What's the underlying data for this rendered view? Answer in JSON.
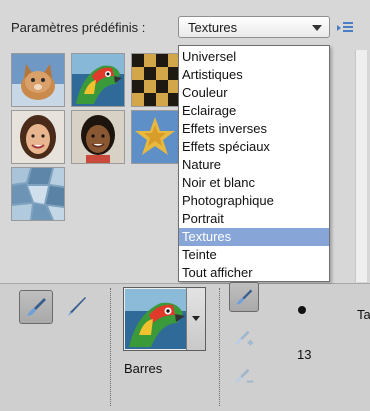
{
  "presets": {
    "label": "Paramètres prédéfinis :",
    "selected": "Textures",
    "options": [
      "Universel",
      "Artistiques",
      "Couleur",
      "Eclairage",
      "Effets inverses",
      "Effets spéciaux",
      "Nature",
      "Noir et blanc",
      "Photographique",
      "Portrait",
      "Textures",
      "Teinte",
      "Tout afficher"
    ],
    "selected_index": 10,
    "panel_menu_icon": "panel-menu-icon"
  },
  "thumbnails": [
    {
      "name": "cat",
      "icon": "cat-thumbnail"
    },
    {
      "name": "parrot",
      "icon": "parrot-thumbnail"
    },
    {
      "name": "checkerboard",
      "icon": "checker-thumbnail"
    },
    {
      "name": "woman",
      "icon": "portrait-thumbnail"
    },
    {
      "name": "girl",
      "icon": "portrait-thumbnail"
    },
    {
      "name": "starfish",
      "icon": "starfish-thumbnail"
    },
    {
      "name": "mosaic",
      "icon": "mosaic-thumbnail"
    }
  ],
  "tools": {
    "brush_icon": "brush-icon",
    "pencil_icon": "pencil-icon",
    "selected_tool": "brush"
  },
  "brush": {
    "name": "Barres",
    "size": "13",
    "size_label_partial": "Ta"
  },
  "colors": {
    "selection": "#87a5d7",
    "panel": "#d7d7d7",
    "accent_icon": "#4a7ec2"
  }
}
